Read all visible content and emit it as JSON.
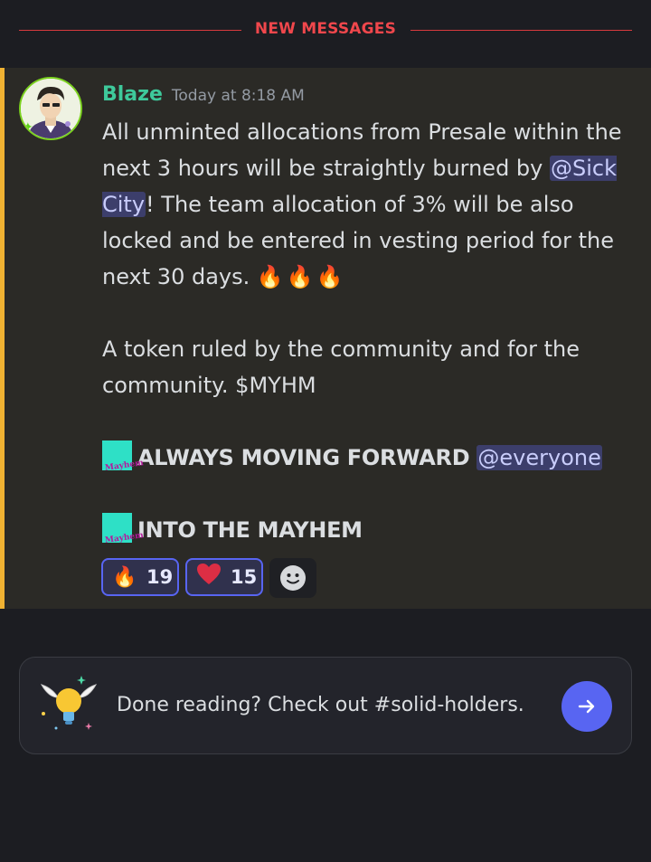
{
  "divider": {
    "label": "NEW MESSAGES"
  },
  "message": {
    "author": "Blaze",
    "timestamp": "Today at 8:18 AM",
    "line1_pre": "All unminted allocations from Presale within the next 3 hours will be straightly burned by ",
    "mention_user": "@Sick City",
    "line1_post": "! The team allocation of 3% will be also locked and be entered in vesting period for the next 30 days. ",
    "fire_emoji": "🔥",
    "paragraph2": "A token ruled by the community and for the community. $MYHM",
    "emoji_label": "Mayhem",
    "line3_text": "ALWAYS MOVING FORWARD ",
    "mention_everyone": "@everyone",
    "line4_text": "INTO THE MAYHEM"
  },
  "reactions": [
    {
      "emoji": "🔥",
      "count": "19"
    },
    {
      "emoji": "❤️",
      "count": "15"
    }
  ],
  "prompt": {
    "text": "Done reading? Check out #solid-holders."
  },
  "colors": {
    "accent": "#5865f2",
    "new_messages": "#f0474c",
    "username": "#3ec99b",
    "highlight_bar": "#f0b232"
  }
}
